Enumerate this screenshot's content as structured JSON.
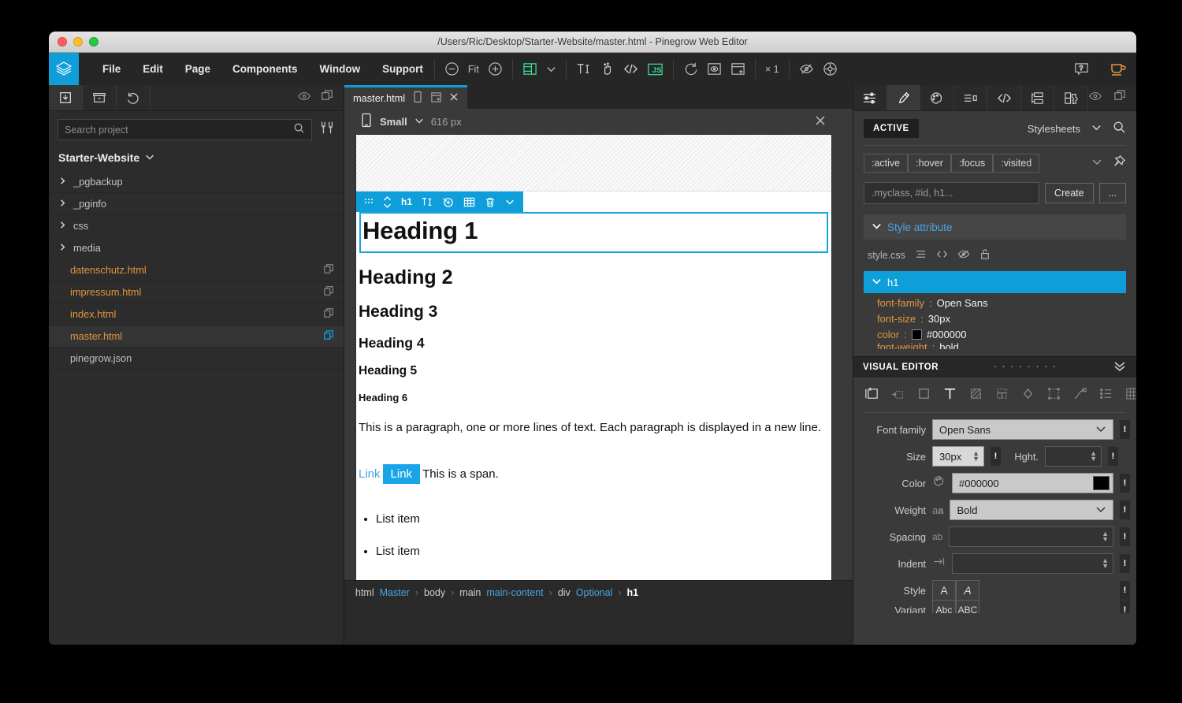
{
  "window": {
    "title": "/Users/Ric/Desktop/Starter-Website/master.html - Pinegrow Web Editor"
  },
  "menubar": {
    "logo": "pinegrow-logo-icon",
    "items": [
      "File",
      "Edit",
      "Page",
      "Components",
      "Window",
      "Support"
    ],
    "zoom": {
      "minus": "−",
      "fit_label": "Fit",
      "plus": "+"
    },
    "scale_label": "× 1"
  },
  "left_panel": {
    "tabs": [
      "import-page-icon",
      "project-box-icon",
      "undo-icon"
    ],
    "tab_right": [
      "eye-icon",
      "panels-icon"
    ],
    "search": {
      "placeholder": "Search project",
      "value": ""
    },
    "project_name": "Starter-Website",
    "tree": [
      {
        "label": "_pgbackup",
        "type": "folder"
      },
      {
        "label": "_pginfo",
        "type": "folder"
      },
      {
        "label": "css",
        "type": "folder"
      },
      {
        "label": "media",
        "type": "folder"
      },
      {
        "label": "datenschutz.html",
        "type": "file"
      },
      {
        "label": "impressum.html",
        "type": "file"
      },
      {
        "label": "index.html",
        "type": "file"
      },
      {
        "label": "master.html",
        "type": "file",
        "selected": true
      },
      {
        "label": "pinegrow.json",
        "type": "plain"
      }
    ]
  },
  "center_panel": {
    "tab": {
      "label": "master.html"
    },
    "device": {
      "name": "Small",
      "width": "616 px"
    },
    "page": {
      "h1": "Heading 1",
      "h2": "Heading 2",
      "h3": "Heading 3",
      "h4": "Heading 4",
      "h5": "Heading 5",
      "h6": "Heading 6",
      "paragraph": "This is a paragraph, one or more lines of text. Each paragraph is displayed in a new line.",
      "link1": "Link",
      "link2": "Link",
      "span_text": "This is a span.",
      "list_items": [
        "List item",
        "List item"
      ]
    },
    "selection_toolbar": {
      "tag": "h1"
    },
    "breadcrumb": [
      {
        "tag": "html",
        "name": "Master"
      },
      {
        "tag": "body",
        "name": ""
      },
      {
        "tag": "main",
        "name": "main-content"
      },
      {
        "tag": "div",
        "name": "Optional"
      },
      {
        "tag": "h1",
        "name": "",
        "current": true
      }
    ]
  },
  "right_panel": {
    "tabs": [
      "sliders-icon",
      "brush-icon",
      "palette-icon",
      "text-align-icon",
      "code-icon",
      "library-icon",
      "plugin-icon"
    ],
    "tab_right": [
      "eye-icon",
      "panels-icon"
    ],
    "active_label": "ACTIVE",
    "stylesheets_label": "Stylesheets",
    "pseudo_classes": [
      ":active",
      ":hover",
      ":focus",
      ":visited"
    ],
    "selector_input": {
      "placeholder": ".myclass, #id, h1...",
      "value": ""
    },
    "create_button": "Create",
    "more_button": "...",
    "style_attribute_label": "Style attribute",
    "stylesheet_file": "style.css",
    "rule": {
      "selector": "h1",
      "properties": [
        {
          "name": "font-family",
          "value": "Open Sans"
        },
        {
          "name": "font-size",
          "value": "30px"
        },
        {
          "name": "color",
          "value": "#000000",
          "swatch": "#000000"
        },
        {
          "name": "font-weight",
          "value": "bold"
        }
      ]
    },
    "visual_editor": {
      "title": "VISUAL EDITOR",
      "fields": {
        "font_family_label": "Font family",
        "font_family_value": "Open Sans",
        "size_label": "Size",
        "size_value": "30px",
        "height_label": "Hght.",
        "height_value": "",
        "color_label": "Color",
        "color_value": "#000000",
        "weight_label": "Weight",
        "weight_value": "Bold",
        "spacing_label": "Spacing",
        "spacing_value": "",
        "indent_label": "Indent",
        "indent_value": "",
        "style_label": "Style",
        "style_options": [
          "A",
          "A"
        ],
        "variant_label": "Variant",
        "variant_options": [
          "Abc",
          "ABC"
        ]
      },
      "important_marker": "!"
    }
  },
  "colors": {
    "accent": "#0e9fda",
    "file_orange": "#e2953f",
    "js_green": "#3ddc97",
    "panel_bg": "#3a3a3a"
  }
}
